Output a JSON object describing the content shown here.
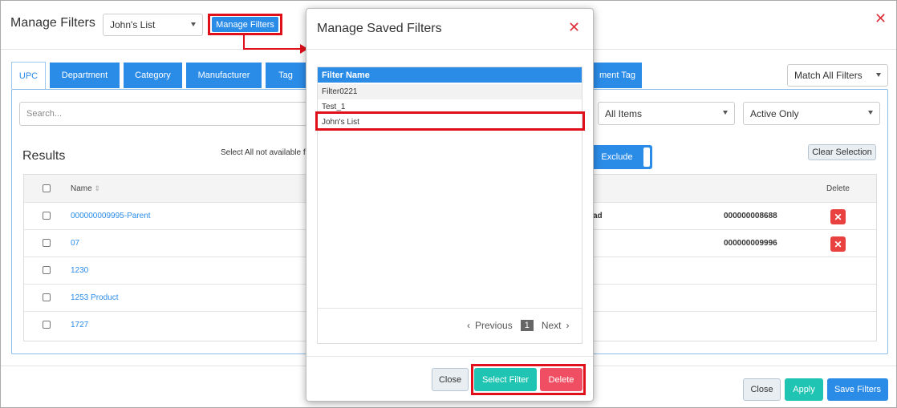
{
  "header": {
    "title": "Manage Filters",
    "list_select": "John's List",
    "manage_button": "Manage Filters"
  },
  "tabs": [
    {
      "label": "UPC"
    },
    {
      "label": "Department"
    },
    {
      "label": "Category"
    },
    {
      "label": "Manufacturer"
    },
    {
      "label": "Tag"
    },
    {
      "label": "ment Tag"
    }
  ],
  "match_select": "Match All Filters",
  "search": {
    "placeholder": "Search..."
  },
  "filters": {
    "items": "All Items",
    "status": "Active Only"
  },
  "results": {
    "title": "Results",
    "select_all_text": "Select All not available f",
    "exclude_label": "Exclude",
    "clear_selection": "Clear Selection",
    "columns": {
      "name": "Name",
      "delete": "Delete"
    },
    "rows": [
      {
        "name": "000000009995-Parent",
        "col_partial": "ad",
        "code": "000000008688"
      },
      {
        "name": "07",
        "col_partial": "",
        "code": "000000009996"
      },
      {
        "name": "1230",
        "col_partial": "",
        "code": ""
      },
      {
        "name": "1253 Product",
        "col_partial": "",
        "code": ""
      },
      {
        "name": "1727",
        "col_partial": "",
        "code": ""
      }
    ]
  },
  "footer": {
    "close": "Close",
    "apply": "Apply",
    "save": "Save Filters"
  },
  "modal": {
    "title": "Manage Saved Filters",
    "column_header": "Filter Name",
    "filters": [
      {
        "name": "Filter0221"
      },
      {
        "name": "Test_1"
      },
      {
        "name": "John's List"
      }
    ],
    "pager": {
      "previous": "Previous",
      "page": "1",
      "next": "Next"
    },
    "buttons": {
      "close": "Close",
      "select": "Select Filter",
      "delete": "Delete"
    }
  },
  "colors": {
    "accent": "#2b8ce8",
    "highlight": "#e0101a",
    "teal": "#20c4b2",
    "danger": "#f04e63"
  },
  "icons": [
    "close-icon",
    "caret-down-icon",
    "sort-icon",
    "chevron-left-icon",
    "chevron-right-icon",
    "arrow-icon",
    "delete-x-icon"
  ]
}
